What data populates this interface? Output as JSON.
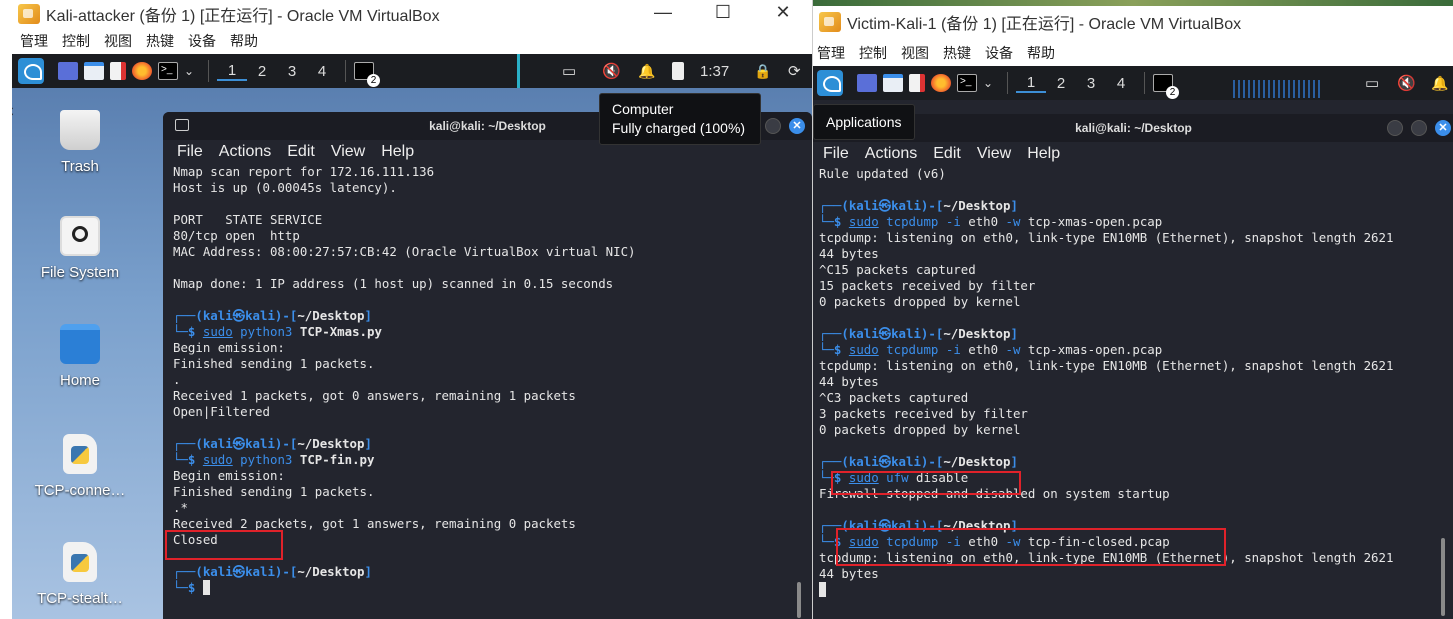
{
  "window_a": {
    "title": "Kali-attacker (备份 1) [正在运行] - Oracle VM VirtualBox",
    "menu": [
      "管理",
      "控制",
      "视图",
      "热键",
      "设备",
      "帮助"
    ],
    "panel": {
      "workspaces": [
        "1",
        "2",
        "3",
        "4"
      ],
      "clock": "1:37",
      "badge": "2"
    },
    "tooltip": {
      "title": "Computer",
      "text": "Fully charged (100%)"
    },
    "desktop_icons": [
      "Trash",
      "File System",
      "Home",
      "TCP-conne…",
      "TCP-stealt…"
    ],
    "terminal": {
      "title": "kali@kali: ~/Desktop",
      "menu": [
        "File",
        "Actions",
        "Edit",
        "View",
        "Help"
      ],
      "lines": [
        "Nmap scan report for 172.16.111.136",
        "Host is up (0.00045s latency).",
        "",
        "PORT   STATE SERVICE",
        "80/tcp open  http",
        "MAC Address: 08:00:27:57:CB:42 (Oracle VirtualBox virtual NIC)",
        "",
        "Nmap done: 1 IP address (1 host up) scanned in 0.15 seconds",
        "",
        "PROMPT",
        "$ sudo python3 TCP-Xmas.py",
        "Begin emission:",
        "Finished sending 1 packets.",
        ".",
        "Received 1 packets, got 0 answers, remaining 1 packets",
        "Open|Filtered",
        "",
        "PROMPT",
        "$ sudo python3 TCP-fin.py",
        "Begin emission:",
        "Finished sending 1 packets.",
        ".*",
        "Received 2 packets, got 1 answers, remaining 0 packets",
        "Closed",
        "",
        "PROMPT",
        "$ "
      ]
    }
  },
  "window_b": {
    "title": "Victim-Kali-1 (备份 1) [正在运行] - Oracle VM VirtualBox",
    "menu": [
      "管理",
      "控制",
      "视图",
      "热键",
      "设备",
      "帮助"
    ],
    "panel": {
      "workspaces": [
        "1",
        "2",
        "3",
        "4"
      ],
      "badge": "2"
    },
    "tooltip": {
      "text": "Applications"
    },
    "terminal": {
      "title": "kali@kali: ~/Desktop",
      "menu": [
        "File",
        "Actions",
        "Edit",
        "View",
        "Help"
      ],
      "lines": [
        "Rule updated (v6)",
        "",
        "PROMPT",
        "$ sudo tcpdump -i eth0 -w tcp-xmas-open.pcap",
        "tcpdump: listening on eth0, link-type EN10MB (Ethernet), snapshot length 2621",
        "44 bytes",
        "^C15 packets captured",
        "15 packets received by filter",
        "0 packets dropped by kernel",
        "",
        "PROMPT",
        "$ sudo tcpdump -i eth0 -w tcp-xmas-open.pcap",
        "tcpdump: listening on eth0, link-type EN10MB (Ethernet), snapshot length 2621",
        "44 bytes",
        "^C3 packets captured",
        "3 packets received by filter",
        "0 packets dropped by kernel",
        "",
        "PROMPT",
        "$ sudo ufw disable",
        "Firewall stopped and disabled on system startup",
        "",
        "PROMPT",
        "$ sudo tcpdump -i eth0 -w tcp-fin-closed.pcap",
        "tcpdump: listening on eth0, link-type EN10MB (Ethernet), snapshot length 2621",
        "44 bytes",
        "CURSOR"
      ]
    }
  },
  "prompt": {
    "user": "kali",
    "host": "kali",
    "dir": "~/Desktop",
    "at": "㉿"
  },
  "colors": {
    "accent": "#3b8eea",
    "highlight_box": "#e0222a",
    "terminal_bg": "#23252e"
  }
}
